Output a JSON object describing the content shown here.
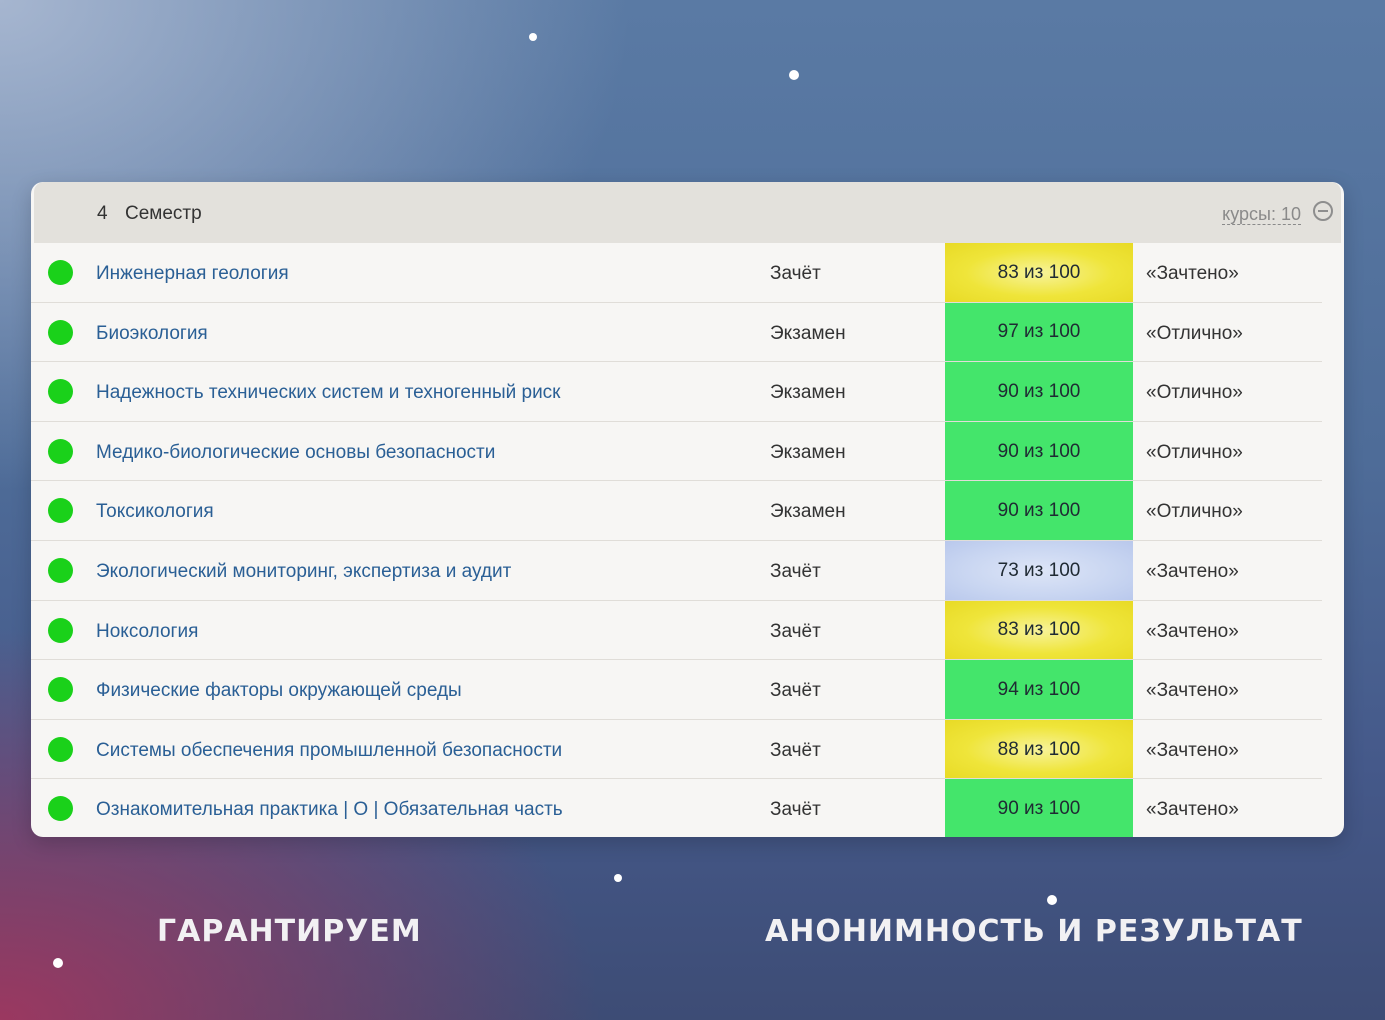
{
  "semester": {
    "number": "4",
    "label": "Семестр",
    "courses_count": "курсы: 10"
  },
  "courses": [
    {
      "name": "Инженерная геология",
      "control": "Зачёт",
      "score": "83 из 100",
      "grade": "«Зачтено»",
      "score_color": "yellow"
    },
    {
      "name": "Биоэкология",
      "control": "Экзамен",
      "score": "97 из 100",
      "grade": "«Отлично»",
      "score_color": "green"
    },
    {
      "name": "Надежность технических систем и техногенный риск",
      "control": "Экзамен",
      "score": "90 из 100",
      "grade": "«Отлично»",
      "score_color": "green"
    },
    {
      "name": "Медико-биологические основы безопасности",
      "control": "Экзамен",
      "score": "90 из 100",
      "grade": "«Отлично»",
      "score_color": "green"
    },
    {
      "name": "Токсикология",
      "control": "Экзамен",
      "score": "90 из 100",
      "grade": "«Отлично»",
      "score_color": "green"
    },
    {
      "name": "Экологический мониторинг, экспертиза и аудит",
      "control": "Зачёт",
      "score": "73 из 100",
      "grade": "«Зачтено»",
      "score_color": "blue"
    },
    {
      "name": "Ноксология",
      "control": "Зачёт",
      "score": "83 из 100",
      "grade": "«Зачтено»",
      "score_color": "yellow"
    },
    {
      "name": "Физические факторы окружающей среды",
      "control": "Зачёт",
      "score": "94 из 100",
      "grade": "«Зачтено»",
      "score_color": "green"
    },
    {
      "name": "Системы обеспечения промышленной безопасности",
      "control": "Зачёт",
      "score": "88 из 100",
      "grade": "«Зачтено»",
      "score_color": "yellow"
    },
    {
      "name": "Ознакомительная практика | О | Обязательная часть",
      "control": "Зачёт",
      "score": "90 из 100",
      "grade": "«Зачтено»",
      "score_color": "green"
    }
  ],
  "colors": {
    "status_dot": "#1ad11a",
    "score_green": "#44e56b",
    "score_yellow": "#efe53a",
    "score_blue": "#c8d5f1",
    "link": "#2a5f95"
  },
  "banner": {
    "left_text": "ГАРАНТИРУЕМ",
    "right_text": "АНОНИМНОСТЬ И РЕЗУЛЬТАТ"
  }
}
